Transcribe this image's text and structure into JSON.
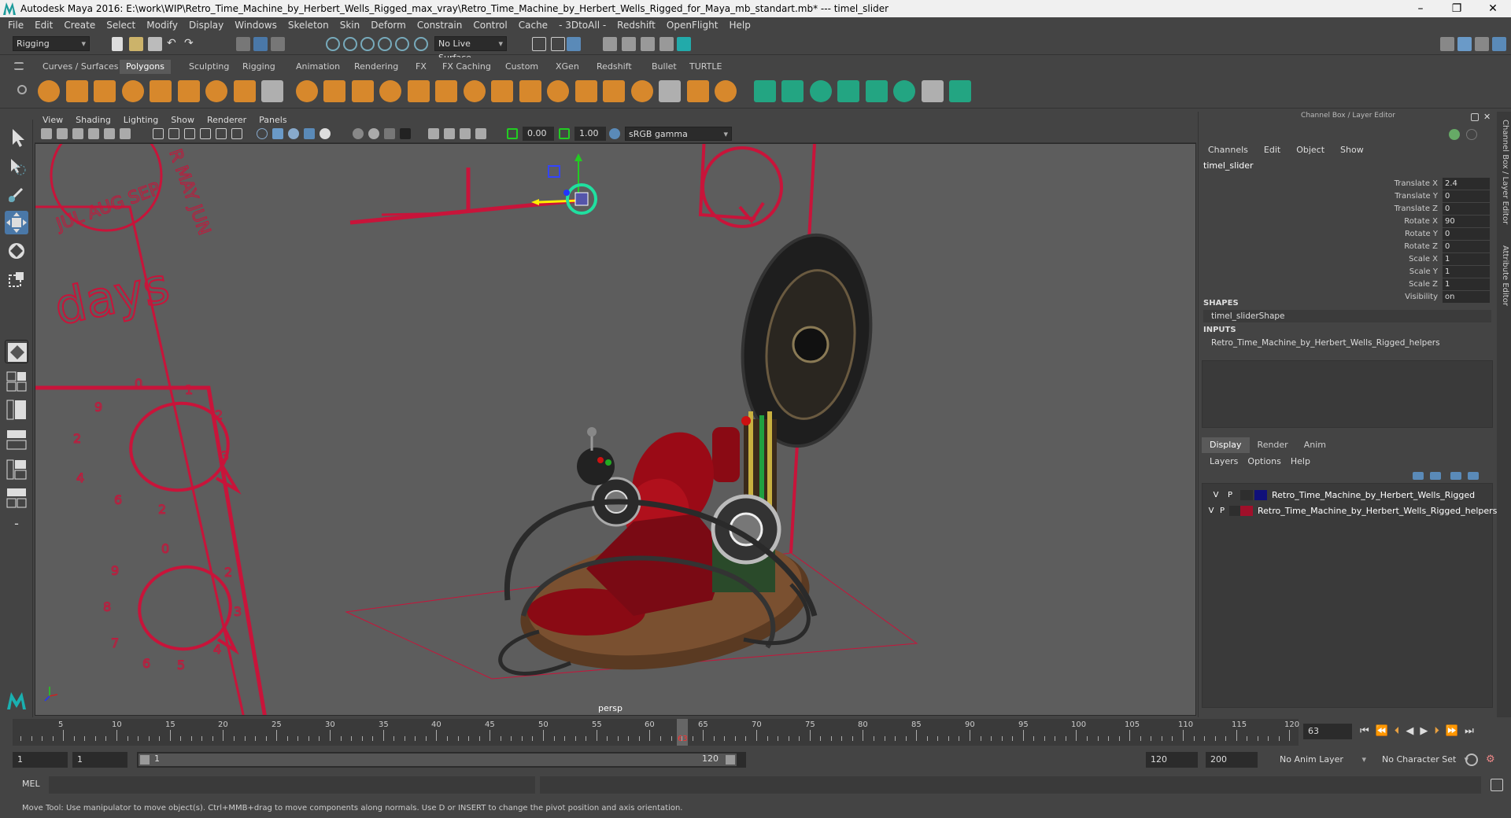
{
  "titlebar": {
    "title": "Autodesk Maya 2016: E:\\work\\WIP\\Retro_Time_Machine_by_Herbert_Wells_Rigged_max_vray\\Retro_Time_Machine_by_Herbert_Wells_Rigged_for_Maya_mb_standart.mb*   ---   timel_slider",
    "minimize": "–",
    "restore": "❐",
    "close": "✕"
  },
  "menubar": [
    "File",
    "Edit",
    "Create",
    "Select",
    "Modify",
    "Display",
    "Windows",
    "Skeleton",
    "Skin",
    "Deform",
    "Constrain",
    "Control",
    "Cache",
    "- 3DtoAll -",
    "Redshift",
    "OpenFlight",
    "Help"
  ],
  "statusline": {
    "mode": "Rigging",
    "live_surface": "No Live Surface"
  },
  "shelf_tabs": [
    "Curves / Surfaces",
    "Polygons",
    "Sculpting",
    "Rigging",
    "Animation",
    "Rendering",
    "FX",
    "FX Caching",
    "Custom",
    "XGen",
    "Redshift",
    "Bullet",
    "TURTLE"
  ],
  "shelf_active": "Polygons",
  "panel_menu": [
    "View",
    "Shading",
    "Lighting",
    "Show",
    "Renderer",
    "Panels"
  ],
  "panel_toolbar": {
    "exposure": "0.00",
    "gamma": "1.00",
    "color_space": "sRGB gamma"
  },
  "viewport": {
    "camera_label": "persp",
    "months_text": "JUL AUG SEP",
    "months_text2": "R MAY JUN",
    "days_text": "days",
    "dial1": [
      "0",
      "1",
      "2",
      "3",
      "4",
      "5",
      "6",
      "7",
      "8",
      "9"
    ],
    "dial2": [
      "0",
      "1",
      "2",
      "3",
      "4",
      "5",
      "6",
      "7",
      "8",
      "9"
    ]
  },
  "channel_box": {
    "header": "Channel Box / Layer Editor",
    "menu": [
      "Channels",
      "Edit",
      "Object",
      "Show"
    ],
    "object_name": "timel_slider",
    "attributes": [
      {
        "label": "Translate X",
        "value": "2.4"
      },
      {
        "label": "Translate Y",
        "value": "0"
      },
      {
        "label": "Translate Z",
        "value": "0"
      },
      {
        "label": "Rotate X",
        "value": "90"
      },
      {
        "label": "Rotate Y",
        "value": "0"
      },
      {
        "label": "Rotate Z",
        "value": "0"
      },
      {
        "label": "Scale X",
        "value": "1"
      },
      {
        "label": "Scale Y",
        "value": "1"
      },
      {
        "label": "Scale Z",
        "value": "1"
      },
      {
        "label": "Visibility",
        "value": "on"
      }
    ],
    "shapes_header": "SHAPES",
    "shape_name": "timel_sliderShape",
    "inputs_header": "INPUTS",
    "input_name": "Retro_Time_Machine_by_Herbert_Wells_Rigged_helpers"
  },
  "layer_editor": {
    "tabs": [
      "Display",
      "Render",
      "Anim"
    ],
    "active_tab": "Display",
    "menu": [
      "Layers",
      "Options",
      "Help"
    ],
    "layers": [
      {
        "v": "V",
        "p": "P",
        "name": "Retro_Time_Machine_by_Herbert_Wells_Rigged",
        "color": "#10107a"
      },
      {
        "v": "V",
        "p": "P",
        "name": "Retro_Time_Machine_by_Herbert_Wells_Rigged_helpers",
        "color": "#a0102a"
      }
    ]
  },
  "side_tabs": [
    "Channel Box / Layer Editor",
    "Attribute Editor"
  ],
  "time_slider": {
    "ticks": [
      "5",
      "10",
      "15",
      "20",
      "25",
      "30",
      "35",
      "40",
      "45",
      "50",
      "55",
      "60",
      "65",
      "70",
      "75",
      "80",
      "85",
      "90",
      "95",
      "100",
      "105",
      "110",
      "115",
      "120"
    ],
    "current_frame": "63",
    "current_field": "63"
  },
  "range": {
    "start": "1",
    "playback_start": "1",
    "range_start": "1",
    "range_end": "120",
    "playback_end": "120",
    "end": "200",
    "anim_layer": "No Anim Layer",
    "character_set": "No Character Set"
  },
  "command": {
    "label": "MEL"
  },
  "help_line": "Move Tool: Use manipulator to move object(s). Ctrl+MMB+drag to move components along normals. Use D or INSERT to change the pivot position and axis orientation."
}
